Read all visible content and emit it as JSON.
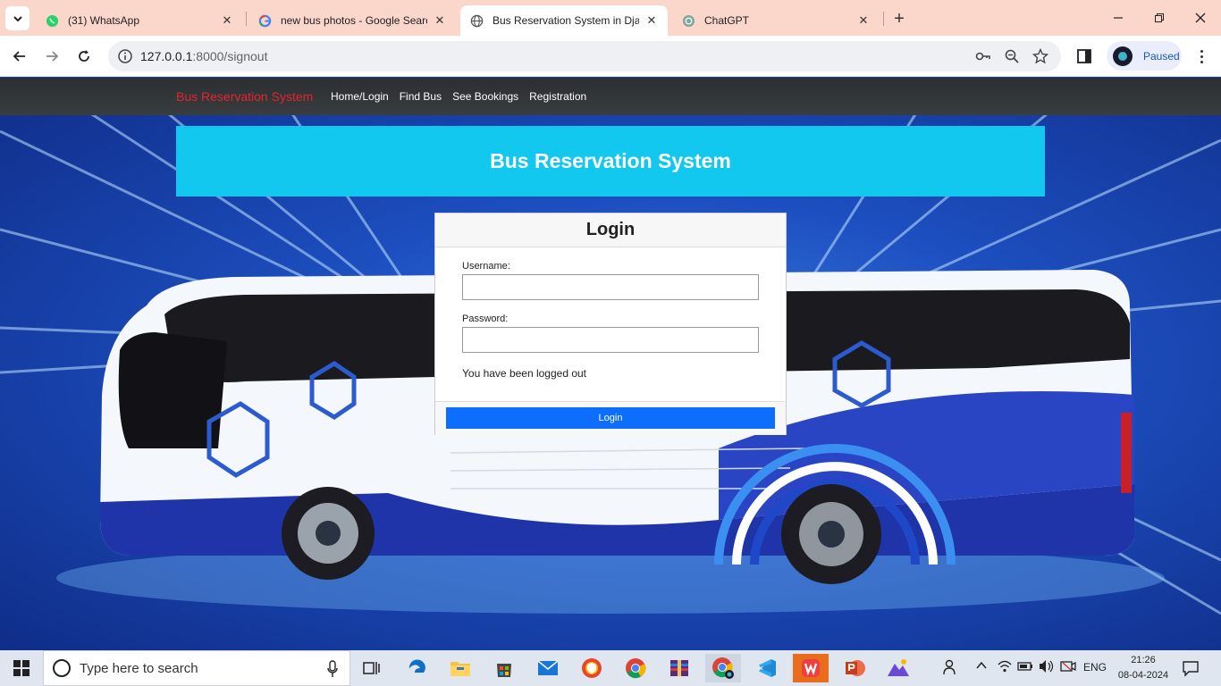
{
  "browser": {
    "tabs": [
      {
        "title": "(31) WhatsApp",
        "icon": "whatsapp-icon"
      },
      {
        "title": "new bus photos - Google Searc",
        "icon": "google-icon"
      },
      {
        "title": "Bus Reservation System in Djan",
        "icon": "globe-icon"
      },
      {
        "title": "ChatGPT",
        "icon": "chatgpt-icon"
      }
    ],
    "url_host": "127.0.0.1",
    "url_path": ":8000/signout",
    "profile_status": "Paused"
  },
  "nav": {
    "brand": "Bus Reservation System",
    "links": [
      "Home/Login",
      "Find Bus",
      "See Bookings",
      "Registration"
    ]
  },
  "hero": {
    "title": "Bus Reservation System"
  },
  "login": {
    "heading": "Login",
    "username_label": "Username:",
    "username_value": "",
    "password_label": "Password:",
    "password_value": "",
    "message": "You have been logged out",
    "button": "Login"
  },
  "taskbar": {
    "search_placeholder": "Type here to search",
    "language": "ENG",
    "time": "21:26",
    "date": "08-04-2024"
  },
  "colors": {
    "accent": "#0d6efd",
    "brand_red": "#e0262e",
    "hero_cyan": "#12c8ee",
    "tabstrip": "#fbd7cb"
  }
}
